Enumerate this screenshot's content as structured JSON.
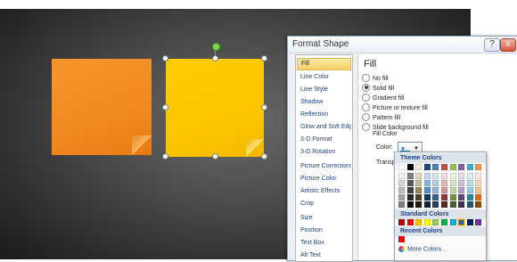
{
  "dialog": {
    "title": "Format Shape",
    "help_icon": "?",
    "close_icon": "x"
  },
  "nav": {
    "items": [
      {
        "label": "Fill",
        "selected": true
      },
      {
        "label": "Line Color"
      },
      {
        "label": "Line Style"
      },
      {
        "label": "Shadow"
      },
      {
        "label": "Reflection"
      },
      {
        "label": "Glow and Soft Edges"
      },
      {
        "label": "3-D Format"
      },
      {
        "label": "3-D Rotation"
      },
      {
        "label": "Picture Corrections"
      },
      {
        "label": "Picture Color"
      },
      {
        "label": "Artistic Effects"
      },
      {
        "label": "Crop"
      },
      {
        "label": "Size"
      },
      {
        "label": "Position"
      },
      {
        "label": "Text Box"
      },
      {
        "label": "Alt Text"
      }
    ]
  },
  "fill": {
    "heading": "Fill",
    "options": [
      {
        "label": "No fill",
        "checked": false
      },
      {
        "label": "Solid fill",
        "checked": true
      },
      {
        "label": "Gradient fill",
        "checked": false
      },
      {
        "label": "Picture or texture fill",
        "checked": false
      },
      {
        "label": "Pattern fill",
        "checked": false
      },
      {
        "label": "Slide background fill",
        "checked": false
      }
    ],
    "fill_color_label": "Fill Color",
    "color_label": "Color:",
    "transparency_label": "Transparency:",
    "selected_color": "#0070c0"
  },
  "palette": {
    "theme_colors_label": "Theme Colors",
    "standard_colors_label": "Standard Colors",
    "recent_colors_label": "Recent Colors",
    "more_colors_label": "More Colors...",
    "theme_top": [
      "#ffffff",
      "#000000",
      "#eeece1",
      "#1f497d",
      "#4f81bd",
      "#c0504d",
      "#9bbb59",
      "#8064a2",
      "#4bacc6",
      "#f79646"
    ],
    "theme_shades": [
      [
        "#f2f2f2",
        "#7f7f7f",
        "#ddd9c3",
        "#c6d9f0",
        "#dbe5f1",
        "#f2dcdb",
        "#ebf1dd",
        "#e5e0ec",
        "#dbeef3",
        "#fdeada"
      ],
      [
        "#d8d8d8",
        "#595959",
        "#c4bd97",
        "#8db3e2",
        "#b8cce4",
        "#e5b9b7",
        "#d7e3bc",
        "#ccc1d9",
        "#b7dde8",
        "#fbd5b5"
      ],
      [
        "#bfbfbf",
        "#3f3f3f",
        "#938953",
        "#548dd4",
        "#95b3d7",
        "#d99694",
        "#c3d69b",
        "#b2a2c7",
        "#92cddc",
        "#fac08f"
      ],
      [
        "#a5a5a5",
        "#262626",
        "#494429",
        "#17365d",
        "#366092",
        "#953734",
        "#76923c",
        "#5f497a",
        "#31859b",
        "#e36c09"
      ],
      [
        "#7f7f7f",
        "#0c0c0c",
        "#1d1b10",
        "#0f243e",
        "#244061",
        "#632423",
        "#4f6128",
        "#3f3151",
        "#205867",
        "#974806"
      ]
    ],
    "standard": [
      "#c00000",
      "#ff0000",
      "#ffc000",
      "#ffff00",
      "#92d050",
      "#00b050",
      "#00b0f0",
      "#0070c0",
      "#002060",
      "#7030a0"
    ],
    "recent": [
      "#ff0000"
    ]
  },
  "slide": {
    "note_colors": [
      "#f18a1f",
      "#ffcc00"
    ]
  }
}
